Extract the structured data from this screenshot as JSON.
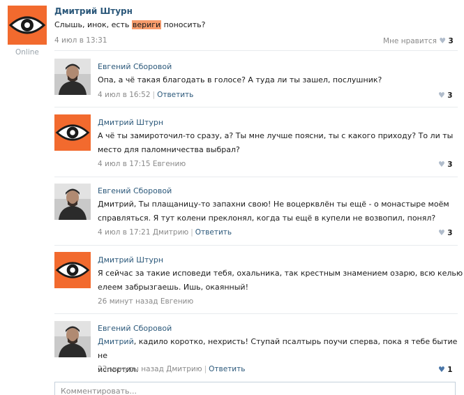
{
  "post": {
    "author": "Дмитрий Штурн",
    "text_before": "Слышь, инок, есть ",
    "text_highlight": "вериги",
    "text_after": " поносить?",
    "date": "4 июл в 13:31",
    "like_label": "Мне нравится",
    "like_count": "3",
    "online": "Online"
  },
  "comments": [
    {
      "author": "Евгений Сборовой",
      "text": "Опа, а чё такая благодать в голосе? А туда ли ты зашел, послушник?",
      "date": "4 июл в 16:52",
      "reply": "Ответить",
      "like_count": "3"
    },
    {
      "author": "Дмитрий Штурн",
      "text_line1": "А чё ты замироточил-то сразу, а? Ты мне лучше поясни, ты с какого приходу? То ли ты",
      "text_line2": "место для паломничества выбрал?",
      "date": "4 июл в 17:15 Евгению",
      "like_count": "3"
    },
    {
      "author": "Евгений Сборовой",
      "text_line1": "Дмитрий, Ты плащаницу-то запахни свою! Не воцерквлён ты ещё - о монастыре моём",
      "text_line2": "справляться. Я тут колени преклонял, когда ты ещё в купели не возвопил, понял?",
      "date": "4 июл в 17:21 Дмитрию",
      "reply": "Ответить",
      "like_count": "3"
    },
    {
      "author": "Дмитрий Штурн",
      "text_line1": "Я сейчас за такие исповеди тебя, охальника, так крестным знамением озарю, всю келью",
      "text_line2": "елеем забрызгаешь. Ишь, окаянный!",
      "date": "26 минут назад Евгению"
    },
    {
      "author": "Евгений Сборовой",
      "mention": "Дмитрий",
      "text_line1_rest": ", кадило коротко, нехристь! Ступай псалтырь поучи сперва, пока я тебе бытие не",
      "text_line2": "испортил.",
      "date": "23 минуты назад Дмитрию",
      "reply": "Ответить",
      "like_count": "1"
    }
  ],
  "comment_input": {
    "placeholder": "Комментировать..."
  },
  "icons": {
    "eye_avatar": "eye-icon",
    "heart": "heart-icon"
  },
  "colors": {
    "orange": "#f26a2e",
    "link": "#2b587a",
    "highlight": "#f79c6c"
  }
}
